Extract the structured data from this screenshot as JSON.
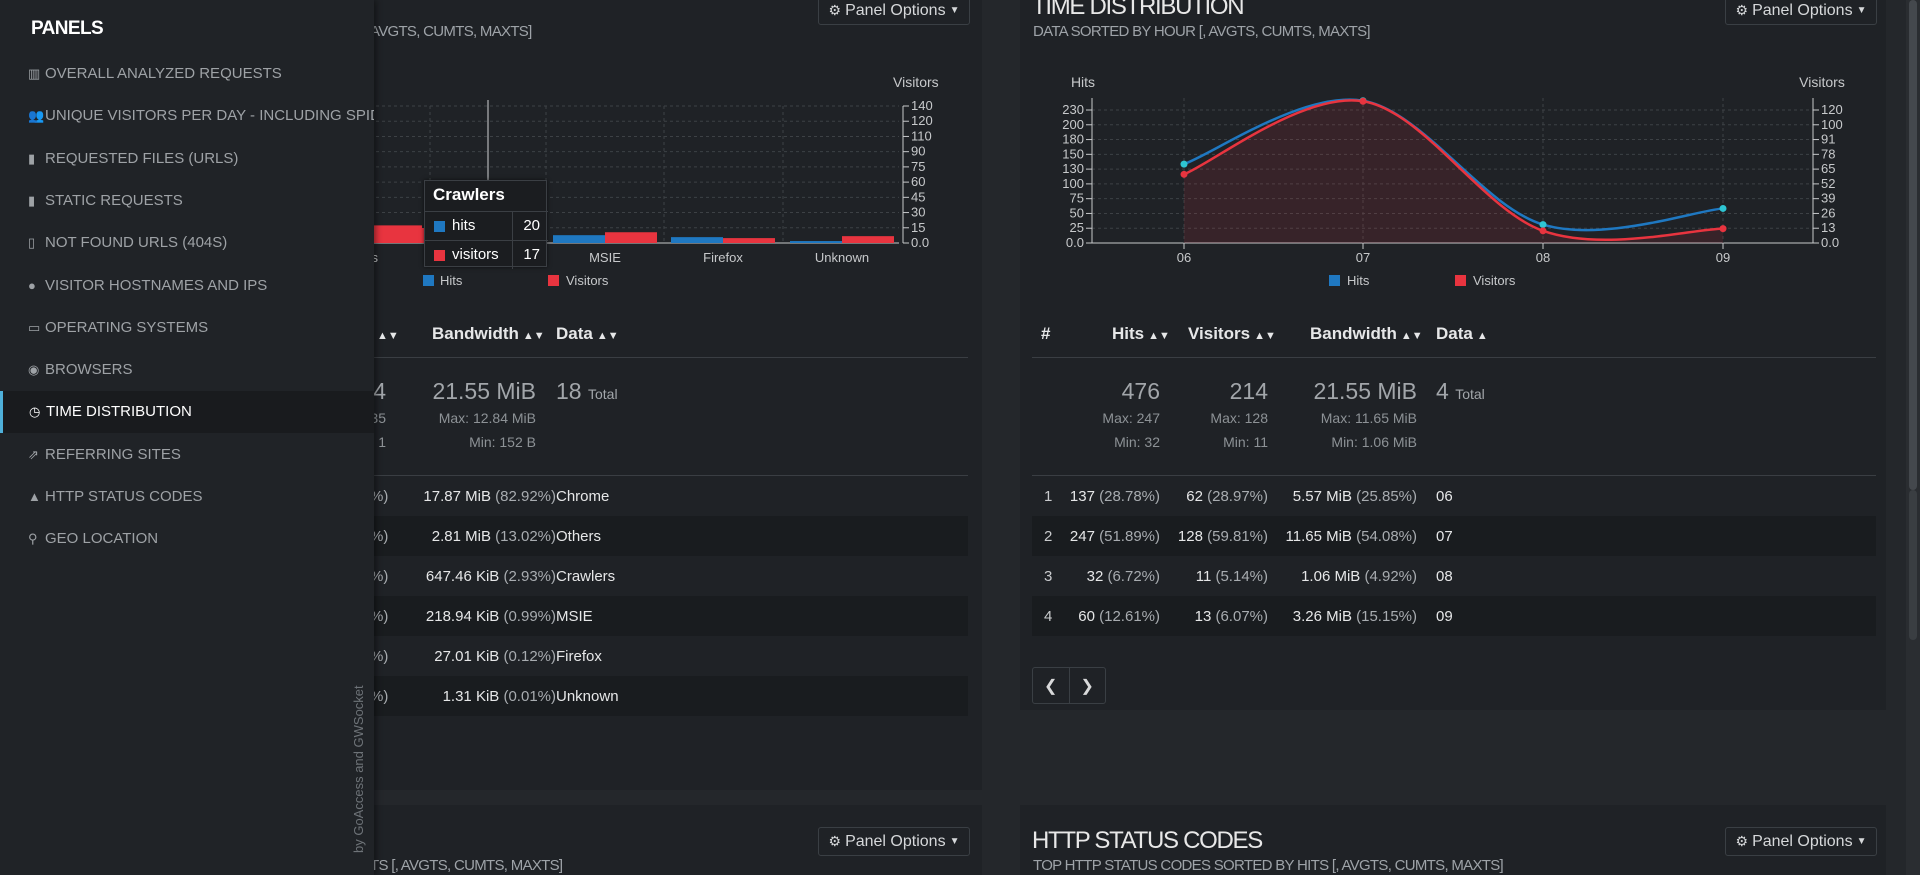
{
  "sidebar": {
    "title": "PANELS",
    "items": [
      {
        "label": "OVERALL ANALYZED REQUESTS",
        "icon": "bar-chart-icon"
      },
      {
        "label": "UNIQUE VISITORS PER DAY - INCLUDING SPIDERS",
        "icon": "users-icon"
      },
      {
        "label": "REQUESTED FILES (URLS)",
        "icon": "file-icon"
      },
      {
        "label": "STATIC REQUESTS",
        "icon": "file-icon"
      },
      {
        "label": "NOT FOUND URLS (404S)",
        "icon": "file-outline-icon"
      },
      {
        "label": "VISITOR HOSTNAMES AND IPS",
        "icon": "user-icon"
      },
      {
        "label": "OPERATING SYSTEMS",
        "icon": "desktop-icon"
      },
      {
        "label": "BROWSERS",
        "icon": "chrome-icon"
      },
      {
        "label": "TIME DISTRIBUTION",
        "icon": "clock-icon",
        "active": true
      },
      {
        "label": "REFERRING SITES",
        "icon": "external-link-icon"
      },
      {
        "label": "HTTP STATUS CODES",
        "icon": "warning-icon"
      },
      {
        "label": "GEO LOCATION",
        "icon": "map-marker-icon"
      }
    ],
    "credit_prefix": "by ",
    "credit_a": "GoAccess",
    "credit_mid": " and ",
    "credit_b": "GWSocket"
  },
  "panel_options_label": "Panel Options",
  "browsers_panel": {
    "subtitle": "AVGTS, CUMTS, MAXTS]",
    "headers": {
      "bandwidth": "Bandwidth",
      "data": "Data"
    },
    "summary": {
      "hits_partial": "4",
      "hits_max_partial": "35",
      "hits_min_partial": "1",
      "bandwidth": "21.55 MiB",
      "bandwidth_max": "Max: 12.84 MiB",
      "bandwidth_min": "Min: 152 B",
      "data": "18",
      "data_suffix": "Total"
    },
    "rows": [
      {
        "pct_partial": "%)",
        "bw": "17.87 MiB",
        "bw_pct": "(82.92%)",
        "data": "Chrome"
      },
      {
        "pct_partial": "%)",
        "bw": "2.81 MiB",
        "bw_pct": "(13.02%)",
        "data": "Others"
      },
      {
        "pct_partial": "%)",
        "bw": "647.46 KiB",
        "bw_pct": "(2.93%)",
        "data": "Crawlers"
      },
      {
        "pct_partial": "%)",
        "bw": "218.94 KiB",
        "bw_pct": "(0.99%)",
        "data": "MSIE"
      },
      {
        "pct_partial": "%)",
        "bw": "27.01 KiB",
        "bw_pct": "(0.12%)",
        "data": "Firefox"
      },
      {
        "pct_partial": "%)",
        "bw": "1.31 KiB",
        "bw_pct": "(0.01%)",
        "data": "Unknown"
      }
    ],
    "tooltip": {
      "title": "Crawlers",
      "hits_label": "hits",
      "hits": "20",
      "visitors_label": "visitors",
      "visitors": "17"
    }
  },
  "time_panel": {
    "title": "TIME DISTRIBUTION",
    "subtitle": "DATA SORTED BY HOUR [, AVGTS, CUMTS, MAXTS]",
    "headers": {
      "num": "#",
      "hits": "Hits",
      "visitors": "Visitors",
      "bandwidth": "Bandwidth",
      "data": "Data"
    },
    "summary": {
      "hits": "476",
      "hits_max": "Max: 247",
      "hits_min": "Min: 32",
      "visitors": "214",
      "visitors_max": "Max: 128",
      "visitors_min": "Min: 11",
      "bandwidth": "21.55 MiB",
      "bandwidth_max": "Max: 11.65 MiB",
      "bandwidth_min": "Min: 1.06 MiB",
      "data": "4",
      "data_suffix": "Total"
    },
    "rows": [
      {
        "n": "1",
        "hits": "137",
        "hits_pct": "(28.78%)",
        "vis": "62",
        "vis_pct": "(28.97%)",
        "bw": "5.57 MiB",
        "bw_pct": "(25.85%)",
        "data": "06"
      },
      {
        "n": "2",
        "hits": "247",
        "hits_pct": "(51.89%)",
        "vis": "128",
        "vis_pct": "(59.81%)",
        "bw": "11.65 MiB",
        "bw_pct": "(54.08%)",
        "data": "07"
      },
      {
        "n": "3",
        "hits": "32",
        "hits_pct": "(6.72%)",
        "vis": "11",
        "vis_pct": "(5.14%)",
        "bw": "1.06 MiB",
        "bw_pct": "(4.92%)",
        "data": "08"
      },
      {
        "n": "4",
        "hits": "60",
        "hits_pct": "(12.61%)",
        "vis": "13",
        "vis_pct": "(6.07%)",
        "bw": "3.26 MiB",
        "bw_pct": "(15.15%)",
        "data": "09"
      }
    ]
  },
  "bottom_left": {
    "subtitle": "TS [, AVGTS, CUMTS, MAXTS]"
  },
  "status_panel": {
    "title": "HTTP STATUS CODES",
    "subtitle": "TOP HTTP STATUS CODES SORTED BY HITS [, AVGTS, CUMTS, MAXTS]"
  },
  "colors": {
    "hits": "#1f78c1",
    "visitors": "#e8343f",
    "accent": "#4fb0da"
  },
  "chart_data": [
    {
      "type": "bar",
      "categories": [
        "Others",
        "Crawlers",
        "MSIE",
        "Firefox",
        "Unknown"
      ],
      "category_labels": [
        "ers",
        "",
        "MSIE",
        "Firefox",
        "Unknown"
      ],
      "series": [
        {
          "name": "Hits",
          "values": [
            null,
            20,
            8,
            6,
            2
          ]
        },
        {
          "name": "Visitors",
          "values": [
            18,
            17,
            11,
            5,
            7
          ]
        }
      ],
      "ylabel_right": "Visitors",
      "yticks_right": [
        "140",
        "120",
        "110",
        "90",
        "75",
        "60",
        "45",
        "30",
        "15",
        "0.0"
      ],
      "ylim_right": [
        0,
        140
      ],
      "legend": [
        "Hits",
        "Visitors"
      ],
      "legend_position": "bottom"
    },
    {
      "type": "line",
      "x": [
        "06",
        "07",
        "08",
        "09"
      ],
      "series": [
        {
          "name": "Hits",
          "values": [
            137,
            247,
            32,
            60
          ]
        },
        {
          "name": "Visitors",
          "values": [
            62,
            128,
            11,
            13
          ]
        }
      ],
      "ylabel_left": "Hits",
      "ylabel_right": "Visitors",
      "yticks_left": [
        "230",
        "200",
        "180",
        "150",
        "130",
        "100",
        "75",
        "50",
        "25",
        "0.0"
      ],
      "yticks_right": [
        "120",
        "100",
        "91",
        "78",
        "65",
        "52",
        "39",
        "26",
        "13",
        "0.0"
      ],
      "ylim_left": [
        0,
        250
      ],
      "ylim_right": [
        0,
        130
      ],
      "legend": [
        "Hits",
        "Visitors"
      ],
      "legend_position": "bottom"
    }
  ]
}
